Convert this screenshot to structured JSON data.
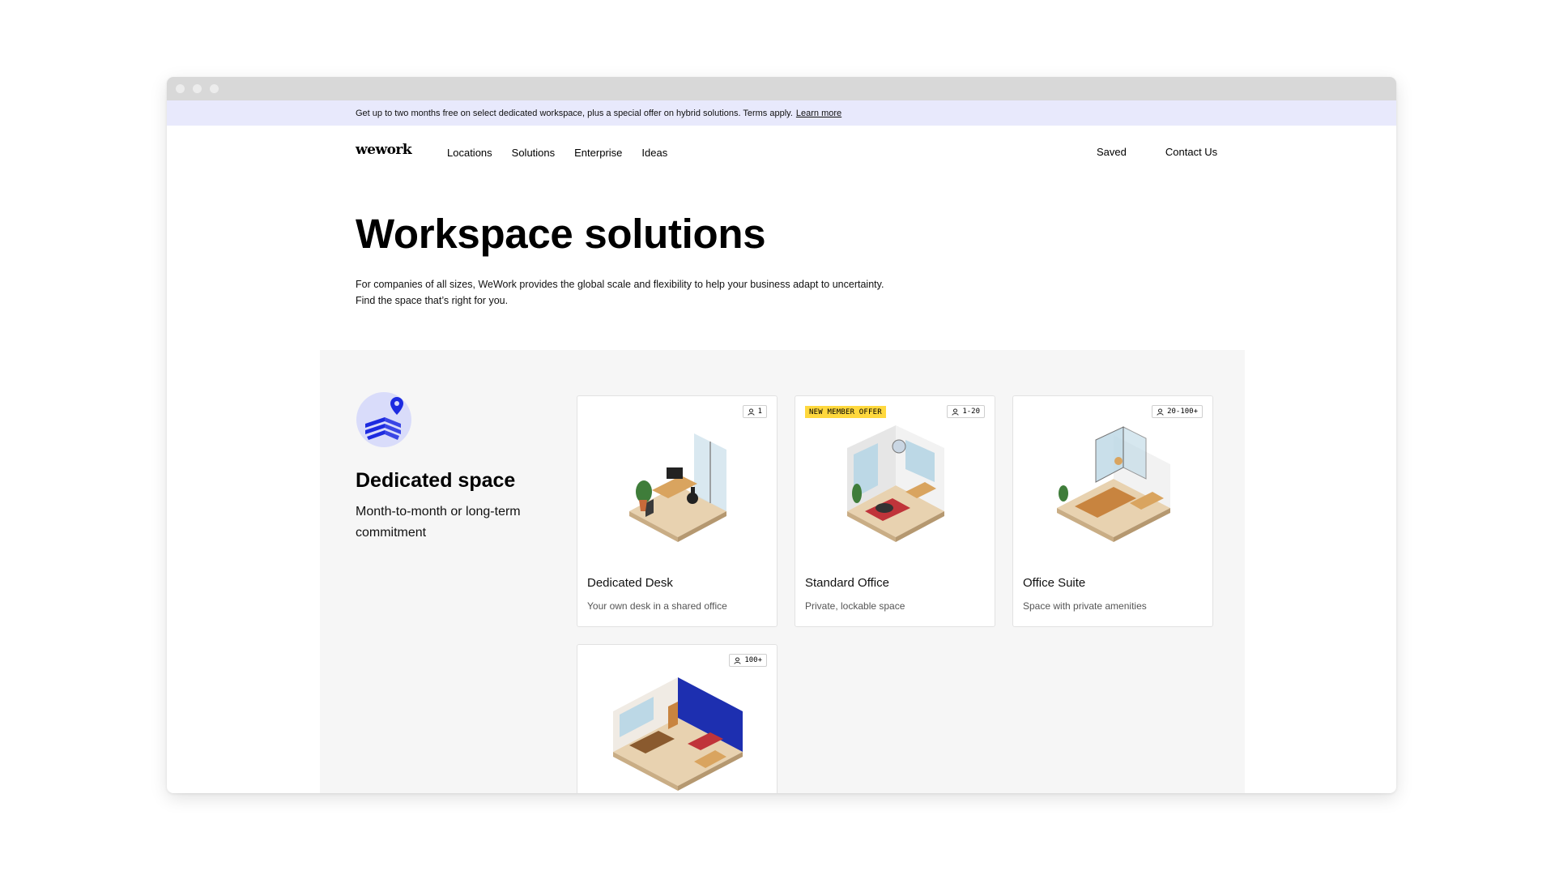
{
  "promo": {
    "text": "Get up to two months free on select dedicated workspace, plus a special offer on hybrid solutions. Terms apply.",
    "link": "Learn more"
  },
  "nav": {
    "logo": "wework",
    "links": [
      "Locations",
      "Solutions",
      "Enterprise",
      "Ideas"
    ],
    "saved": "Saved",
    "contact": "Contact Us"
  },
  "hero": {
    "title": "Workspace solutions",
    "desc_line1": "For companies of all sizes, WeWork provides the global scale and flexibility to help your business adapt to uncertainty.",
    "desc_line2": "Find the space that’s right for you."
  },
  "category": {
    "title": "Dedicated space",
    "subtitle": "Month-to-month or long-term commitment",
    "icon": "building-location-icon"
  },
  "cards": [
    {
      "title": "Dedicated Desk",
      "subtitle": "Your own desk in a shared office",
      "capacity": "1",
      "badge": ""
    },
    {
      "title": "Standard Office",
      "subtitle": "Private, lockable space",
      "capacity": "1-20",
      "badge": "NEW MEMBER OFFER"
    },
    {
      "title": "Office Suite",
      "subtitle": "Space with private amenities",
      "capacity": "20-100+",
      "badge": ""
    },
    {
      "title": "",
      "subtitle": "",
      "capacity": "100+",
      "badge": ""
    }
  ],
  "colors": {
    "promo_bg": "#e8e9fc",
    "badge_yellow": "#ffd83d",
    "brand_blue": "#1d2be0",
    "section_grey": "#f6f6f6"
  }
}
